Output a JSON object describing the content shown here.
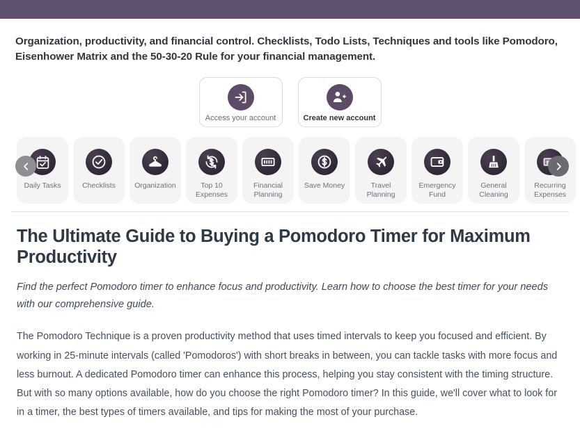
{
  "topbar": {
    "color": "#5f5070"
  },
  "tagline": "Organization, productivity, and financial control. Checklists, Todo Lists, Techniques and tools like Pomodoro, Eisenhower Matrix and the 50-30-20 Rule for your financial management.",
  "auth": {
    "login": {
      "label": "Access your account",
      "icon": "login-arrow-icon"
    },
    "register": {
      "label": "Create new account",
      "icon": "person-add-icon"
    }
  },
  "carousel": {
    "prev_icon": "chevron-left-icon",
    "next_icon": "chevron-right-icon",
    "items": [
      {
        "label": "Daily Tasks",
        "icon": "calendar-check-icon"
      },
      {
        "label": "Checklists",
        "icon": "check-circle-icon"
      },
      {
        "label": "Organization",
        "icon": "clothes-hanger-icon"
      },
      {
        "label": "Top 10 Expenses",
        "icon": "currency-exchange-icon"
      },
      {
        "label": "Financial Planning",
        "icon": "banknote-icon"
      },
      {
        "label": "Save Money",
        "icon": "dollar-coin-icon"
      },
      {
        "label": "Travel Planning",
        "icon": "airplane-icon"
      },
      {
        "label": "Emergency Fund",
        "icon": "wallet-icon"
      },
      {
        "label": "General Cleaning",
        "icon": "broom-icon"
      },
      {
        "label": "Recurring Expenses",
        "icon": "money-arrow-icon"
      }
    ]
  },
  "article": {
    "title": "The Ultimate Guide to Buying a Pomodoro Timer for Maximum Productivity",
    "subtitle": "Find the perfect Pomodoro timer to enhance focus and productivity. Learn how to choose the best timer for your needs with our comprehensive guide.",
    "body": "The Pomodoro Technique is a proven productivity method that uses timed intervals to keep you focused and efficient. By working in 25-minute intervals (called 'Pomodoros') with short breaks in between, you can tackle tasks with more focus and less burnout. A dedicated Pomodoro timer can enhance this process, helping you stay consistent with the timing structure. But with so many options available, how do you choose the right Pomodoro timer? In this guide, we'll cover what to look for in a timer, the best types of timers available, and tips for making the most of your purchase."
  },
  "colors": {
    "brand_purple": "#5f5070",
    "icon_circle": "#5e4b68",
    "card_bg": "#f4f4f5",
    "text_dark": "#2e3947",
    "text_muted": "#707078"
  }
}
